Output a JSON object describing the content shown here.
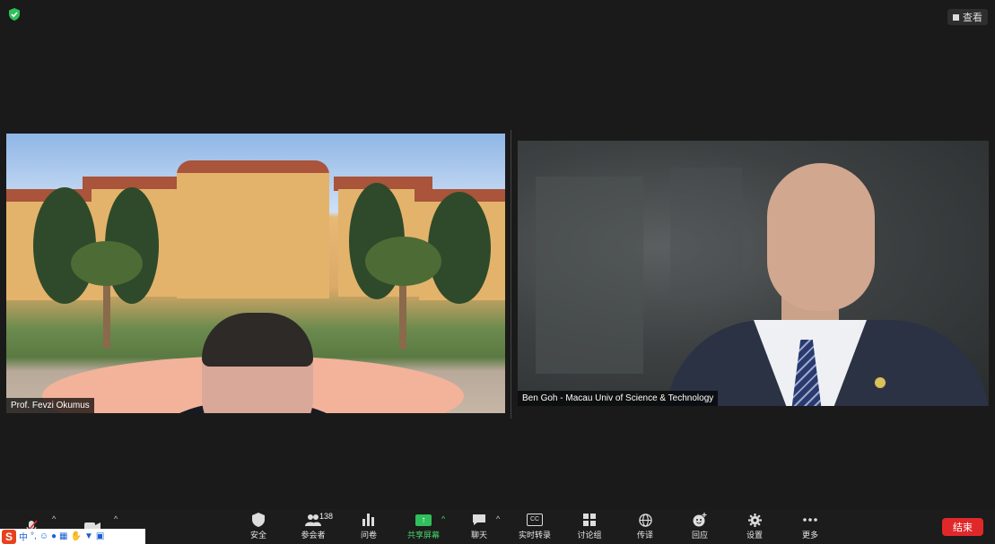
{
  "top_bar": {
    "view_label": "查看",
    "security_icon": "shield-check-icon"
  },
  "participants": [
    {
      "name": "Prof. Fevzi Okumus"
    },
    {
      "name": "Ben Goh - Macau Univ of Science & Technology"
    }
  ],
  "toolbar": {
    "mute": {
      "icon": "microphone-muted-icon"
    },
    "video": {
      "icon": "video-camera-icon"
    },
    "security": {
      "label": "安全",
      "icon": "shield-icon"
    },
    "participants": {
      "label": "参会者",
      "count": "138",
      "icon": "people-icon"
    },
    "polls": {
      "label": "问卷",
      "icon": "bar-chart-icon"
    },
    "share": {
      "label": "共享屏幕",
      "icon": "share-screen-icon",
      "color": "#2fbf5b"
    },
    "chat": {
      "label": "聊天",
      "icon": "chat-bubble-icon"
    },
    "captions": {
      "label": "实时转录",
      "icon_text": "CC"
    },
    "breakout": {
      "label": "讨论组",
      "icon": "grid-icon"
    },
    "interpretation": {
      "label": "传译",
      "icon": "globe-icon"
    },
    "reactions": {
      "label": "回应",
      "icon": "smiley-plus-icon"
    },
    "settings": {
      "label": "设置",
      "icon": "gear-icon"
    },
    "more": {
      "label": "更多",
      "icon": "ellipsis-icon"
    },
    "end": {
      "label": "结束",
      "color": "#e0282a"
    }
  },
  "ime": {
    "logo": "S",
    "mode": "中"
  }
}
